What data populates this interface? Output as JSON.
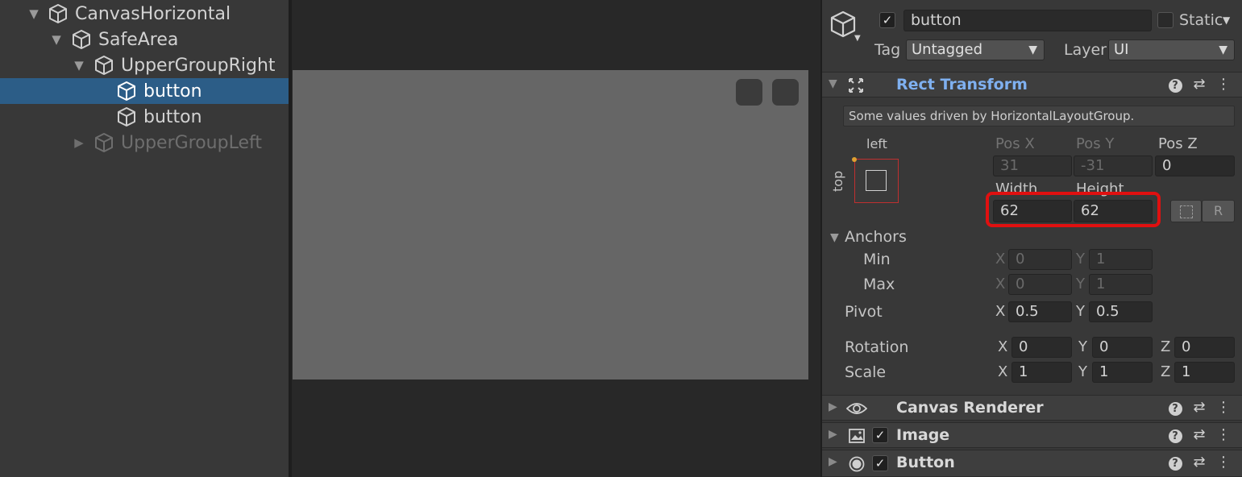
{
  "hierarchy": {
    "items": [
      {
        "label": "CanvasHorizontal",
        "expanded": true
      },
      {
        "label": "SafeArea",
        "expanded": true
      },
      {
        "label": "UpperGroupRight",
        "expanded": true
      },
      {
        "label": "button",
        "selected": true
      },
      {
        "label": "button"
      },
      {
        "label": "UpperGroupLeft",
        "expanded": false,
        "dimmed": true
      }
    ]
  },
  "inspector": {
    "object_name": "button",
    "active": true,
    "static_label": "Static",
    "tag_label": "Tag",
    "tag_value": "Untagged",
    "layer_label": "Layer",
    "layer_value": "UI",
    "rect_transform": {
      "title": "Rect Transform",
      "info": "Some values driven by HorizontalLayoutGroup.",
      "anchor_h": "left",
      "anchor_v": "top",
      "pos_x_label": "Pos X",
      "pos_x": "31",
      "pos_y_label": "Pos Y",
      "pos_y": "-31",
      "pos_z_label": "Pos Z",
      "pos_z": "0",
      "width_label": "Width",
      "width": "62",
      "height_label": "Height",
      "height": "62",
      "raw_button": "R",
      "anchors_label": "Anchors",
      "min_label": "Min",
      "min_x": "0",
      "min_y": "1",
      "max_label": "Max",
      "max_x": "0",
      "max_y": "1",
      "pivot_label": "Pivot",
      "pivot_x": "0.5",
      "pivot_y": "0.5",
      "rotation_label": "Rotation",
      "rot_x": "0",
      "rot_y": "0",
      "rot_z": "0",
      "scale_label": "Scale",
      "scale_x": "1",
      "scale_y": "1",
      "scale_z": "1",
      "axis_x": "X",
      "axis_y": "Y",
      "axis_z": "Z"
    },
    "components": [
      {
        "title": "Canvas Renderer",
        "has_checkbox": false,
        "icon": "eye-icon"
      },
      {
        "title": "Image",
        "has_checkbox": true,
        "enabled": true,
        "icon": "image-icon"
      },
      {
        "title": "Button",
        "has_checkbox": true,
        "enabled": true,
        "icon": "button-icon"
      }
    ]
  },
  "colors": {
    "selection": "#2c5d87",
    "accent_title": "#7fb0f0",
    "highlight": "#e01010",
    "anchor_red": "#c03030",
    "anchor_dot": "#e0a030"
  }
}
